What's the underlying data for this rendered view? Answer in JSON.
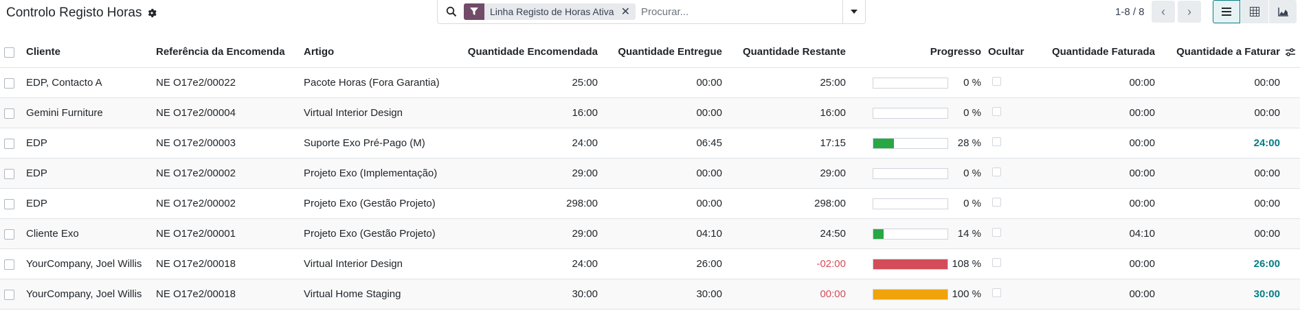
{
  "header": {
    "title": "Controlo Registo Horas",
    "filter_label": "Linha Registo de Horas Ativa",
    "search_placeholder": "Procurar...",
    "pager": "1-8 / 8"
  },
  "colors": {
    "brand": "#714b67",
    "accent": "#017e84",
    "bar_green": "#28a745",
    "bar_red": "#d44c59",
    "bar_orange": "#f0a30a"
  },
  "columns": {
    "cliente": "Cliente",
    "referencia": "Referência da Encomenda",
    "artigo": "Artigo",
    "encomendada": "Quantidade Encomendada",
    "entregue": "Quantidade Entregue",
    "restante": "Quantidade Restante",
    "progresso": "Progresso",
    "ocultar": "Ocultar",
    "faturada": "Quantidade Faturada",
    "a_faturar": "Quantidade a Faturar"
  },
  "rows": [
    {
      "cliente": "EDP, Contacto A",
      "referencia": "NE O17e2/00022",
      "artigo": "Pacote Horas (Fora Garantia)",
      "encomendada": "25:00",
      "entregue": "00:00",
      "restante": "25:00",
      "progress_pct": 0,
      "progress_label": "0 %",
      "bar_color": "",
      "faturada": "00:00",
      "a_faturar": "00:00",
      "negative": false,
      "highlight": false
    },
    {
      "cliente": "Gemini Furniture",
      "referencia": "NE O17e2/00004",
      "artigo": "Virtual Interior Design",
      "encomendada": "16:00",
      "entregue": "00:00",
      "restante": "16:00",
      "progress_pct": 0,
      "progress_label": "0 %",
      "bar_color": "",
      "faturada": "00:00",
      "a_faturar": "00:00",
      "negative": false,
      "highlight": false
    },
    {
      "cliente": "EDP",
      "referencia": "NE O17e2/00003",
      "artigo": "Suporte Exo Pré-Pago (M)",
      "encomendada": "24:00",
      "entregue": "06:45",
      "restante": "17:15",
      "progress_pct": 28,
      "progress_label": "28 %",
      "bar_color": "#28a745",
      "faturada": "00:00",
      "a_faturar": "24:00",
      "negative": false,
      "highlight": true
    },
    {
      "cliente": "EDP",
      "referencia": "NE O17e2/00002",
      "artigo": "Projeto Exo (Implementação)",
      "encomendada": "29:00",
      "entregue": "00:00",
      "restante": "29:00",
      "progress_pct": 0,
      "progress_label": "0 %",
      "bar_color": "",
      "faturada": "00:00",
      "a_faturar": "00:00",
      "negative": false,
      "highlight": false
    },
    {
      "cliente": "EDP",
      "referencia": "NE O17e2/00002",
      "artigo": "Projeto Exo (Gestão Projeto)",
      "encomendada": "298:00",
      "entregue": "00:00",
      "restante": "298:00",
      "progress_pct": 0,
      "progress_label": "0 %",
      "bar_color": "",
      "faturada": "00:00",
      "a_faturar": "00:00",
      "negative": false,
      "highlight": false
    },
    {
      "cliente": "Cliente Exo",
      "referencia": "NE O17e2/00001",
      "artigo": "Projeto Exo (Gestão Projeto)",
      "encomendada": "29:00",
      "entregue": "04:10",
      "restante": "24:50",
      "progress_pct": 14,
      "progress_label": "14 %",
      "bar_color": "#28a745",
      "faturada": "04:10",
      "a_faturar": "00:00",
      "negative": false,
      "highlight": false
    },
    {
      "cliente": "YourCompany, Joel Willis",
      "referencia": "NE O17e2/00018",
      "artigo": "Virtual Interior Design",
      "encomendada": "24:00",
      "entregue": "26:00",
      "restante": "-02:00",
      "progress_pct": 100,
      "progress_label": "108 %",
      "bar_color": "#d44c59",
      "faturada": "00:00",
      "a_faturar": "26:00",
      "negative": true,
      "highlight": true
    },
    {
      "cliente": "YourCompany, Joel Willis",
      "referencia": "NE O17e2/00018",
      "artigo": "Virtual Home Staging",
      "encomendada": "30:00",
      "entregue": "30:00",
      "restante": "00:00",
      "progress_pct": 100,
      "progress_label": "100 %",
      "bar_color": "#f0a30a",
      "faturada": "00:00",
      "a_faturar": "30:00",
      "negative": true,
      "highlight": true
    }
  ]
}
